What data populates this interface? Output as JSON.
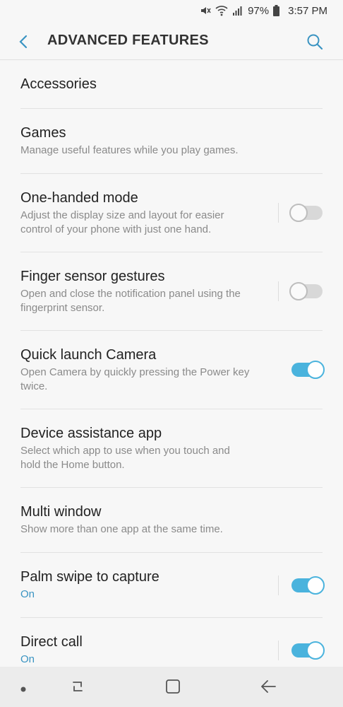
{
  "status": {
    "battery": "97%",
    "time": "3:57 PM",
    "icons": [
      "mute-icon",
      "wifi-icon",
      "signal-icon",
      "battery-icon"
    ]
  },
  "header": {
    "title": "ADVANCED FEATURES",
    "back_icon": "back-arrow-icon",
    "search_icon": "search-icon",
    "accent": "#3a94c2"
  },
  "items": [
    {
      "title": "Accessories",
      "subtitle": ""
    },
    {
      "title": "Games",
      "subtitle": "Manage useful features while you play games."
    },
    {
      "title": "One-handed mode",
      "subtitle": "Adjust the display size and layout for easier control of your phone with just one hand.",
      "toggle": "off"
    },
    {
      "title": "Finger sensor gestures",
      "subtitle": "Open and close the notification panel using the fingerprint sensor.",
      "toggle": "off"
    },
    {
      "title": "Quick launch Camera",
      "subtitle": "Open Camera by quickly pressing the Power key twice.",
      "toggle": "on"
    },
    {
      "title": "Device assistance app",
      "subtitle": "Select which app to use when you touch and hold the Home button."
    },
    {
      "title": "Multi window",
      "subtitle": "Show more than one app at the same time."
    },
    {
      "title": "Palm swipe to capture",
      "subtitle": "On",
      "toggle": "on"
    },
    {
      "title": "Direct call",
      "subtitle": "On",
      "toggle": "on"
    }
  ],
  "navbar": {
    "icons": [
      "dot-icon",
      "recents-icon",
      "home-icon",
      "back-icon"
    ]
  }
}
